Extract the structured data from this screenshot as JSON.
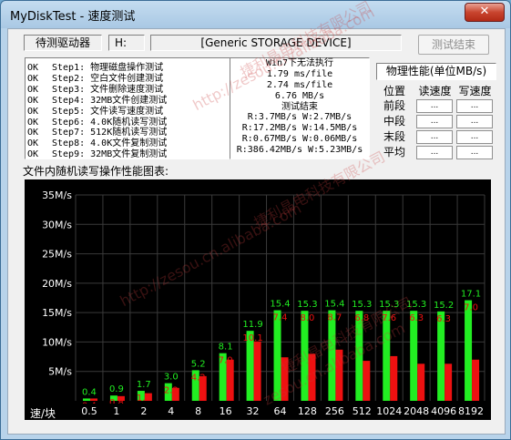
{
  "window": {
    "title": "MyDiskTest - 速度测试",
    "close": "✕"
  },
  "header": {
    "drive_label": "待测驱动器",
    "drive_letter": "H:",
    "device_name": "[Generic STORAGE DEVICE]",
    "stop_button": "测试结束"
  },
  "steps": [
    {
      "status": "OK",
      "label": "Step1: 物理磁盘操作测试"
    },
    {
      "status": "OK",
      "label": "Step2: 空白文件创建测试"
    },
    {
      "status": "OK",
      "label": "Step3: 文件删除速度测试"
    },
    {
      "status": "OK",
      "label": "Step4: 32MB文件创建测试"
    },
    {
      "status": "OK",
      "label": "Step5: 文件读写速度测试"
    },
    {
      "status": "OK",
      "label": "Step6: 4.0K随机读写测试"
    },
    {
      "status": "OK",
      "label": "Step7: 512K随机读写测试"
    },
    {
      "status": "OK",
      "label": "Step8: 4.0K文件复制测试"
    },
    {
      "status": "OK",
      "label": "Step9: 32MB文件复制测试"
    }
  ],
  "results": [
    "Win7下无法执行",
    "1.79 ms/file",
    "2.74 ms/file",
    "6.76 MB/s",
    "测试结束",
    "R:3.7MB/s W:2.7MB/s",
    "R:17.2MB/s W:14.5MB/s",
    "R:0.67MB/s W:0.06MB/s",
    "R:386.42MB/s W:5.23MB/s"
  ],
  "perf": {
    "title": "物理性能(单位MB/s)",
    "headers": [
      "位置",
      "读速度",
      "写速度"
    ],
    "rows": [
      {
        "name": "前段",
        "read": "...",
        "write": "..."
      },
      {
        "name": "中段",
        "read": "...",
        "write": "..."
      },
      {
        "name": "末段",
        "read": "...",
        "write": "..."
      },
      {
        "name": "平均",
        "read": "...",
        "write": "..."
      }
    ]
  },
  "chart_label": "文件内随机读写操作性能图表:",
  "watermarks": [
    "捷利晶电科技有限公司",
    "http://zesou.cn/alibaba.com",
    "捷利晶电科技有限公司",
    "http://zesou.cn.alibaba.com",
    "捷利晶电科技有限公司",
    "zesou.cn.alibaba.com"
  ],
  "chart_data": {
    "type": "bar",
    "xlabel": "速/块",
    "ylabel": "",
    "ylim": [
      0,
      35
    ],
    "y_ticks": [
      "5M/s",
      "10M/s",
      "15M/s",
      "20M/s",
      "25M/s",
      "30M/s",
      "35M/s"
    ],
    "categories": [
      "0.5",
      "1",
      "2",
      "4",
      "8",
      "16",
      "32",
      "64",
      "128",
      "256",
      "512",
      "1024",
      "2048",
      "4096",
      "8192"
    ],
    "series": [
      {
        "color": "#22ee22",
        "values": [
          0.4,
          0.9,
          1.7,
          3.0,
          5.2,
          8.1,
          11.9,
          15.4,
          15.3,
          15.4,
          15.3,
          15.3,
          15.3,
          15.2,
          17.1
        ]
      },
      {
        "color": "#ee1111",
        "values": [
          0.4,
          0.8,
          1.3,
          2.2,
          4.2,
          7.0,
          10.1,
          7.4,
          8.0,
          8.7,
          6.8,
          7.6,
          6.3,
          6.3,
          7.0
        ]
      }
    ],
    "grid": true
  }
}
